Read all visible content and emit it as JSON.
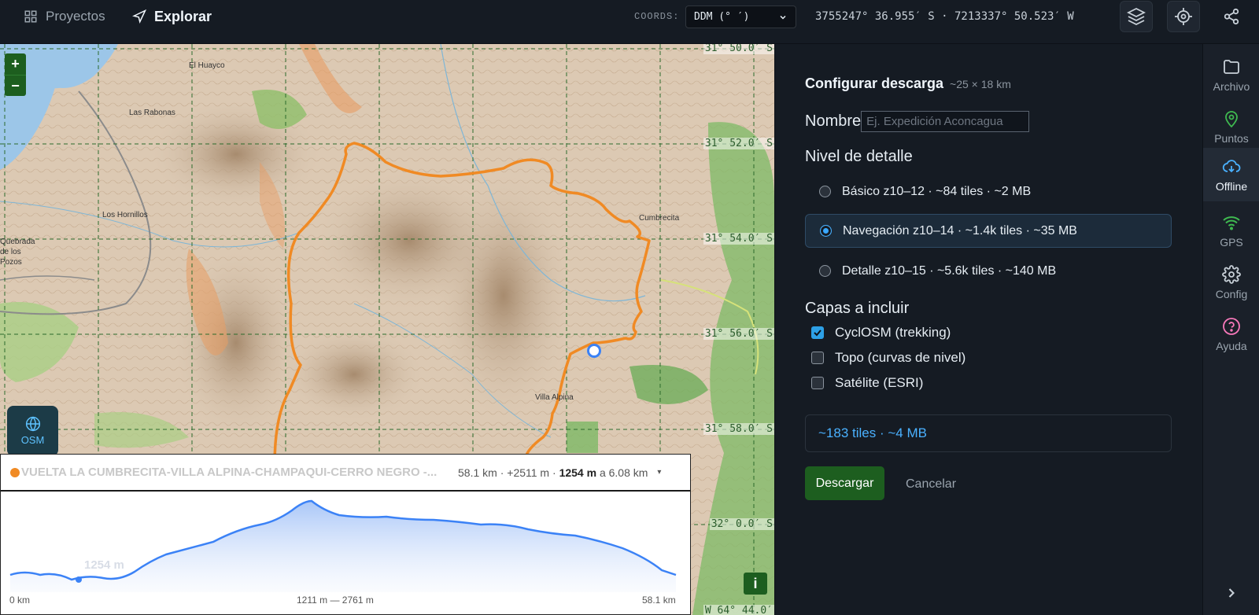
{
  "topbar": {
    "tabs": [
      {
        "label": "Proyectos",
        "icon": "grid-icon"
      },
      {
        "label": "Explorar",
        "icon": "navigation-arrow-icon"
      }
    ],
    "coords_label": "COORDS:",
    "coords_format": "DDM (° ′)",
    "coords_readout": "3755247° 36.955′ S · 7213337° 50.523′ W"
  },
  "map": {
    "lat_labels": [
      "31° 50.0′ S",
      "31° 52.0′ S",
      "31° 54.0′ S",
      "31° 56.0′ S",
      "31° 58.0′ S",
      "32° 0.0′ S",
      "W 64° 44.0′"
    ],
    "places": [
      "El Huayco",
      "Las Rabonas",
      "Los Hornillos",
      "Quebrada de los Pozos",
      "Cumbrecita",
      "Villa Alpina"
    ],
    "basemap_button": "OSM",
    "zoom_in": "+",
    "zoom_out": "−",
    "info_button": "i"
  },
  "elevation": {
    "route_name": "VUELTA LA CUMBRECITA-VILLA ALPINA-CHAMPAQUI-CERRO NEGRO -...",
    "distance": "58.1 km",
    "gain": "+2511 m",
    "cursor_elevation": "1254 m",
    "cursor_at": "a 6.08 km",
    "caret": "▾",
    "axis_start": "0 km",
    "axis_range": "1211 m — 2761 m",
    "axis_end": "58.1 km",
    "cursor_label": "1254 m"
  },
  "panel": {
    "title": "Configurar descarga",
    "subtitle": "~25 × 18 km",
    "name_label": "Nombre",
    "name_placeholder": "Ej. Expedición Aconcagua",
    "detail_heading": "Nivel de detalle",
    "detail_options": [
      {
        "label": "Básico z10–12 · ~84 tiles · ~2 MB",
        "selected": false
      },
      {
        "label": "Navegación z10–14 · ~1.4k tiles · ~35 MB",
        "selected": true
      },
      {
        "label": "Detalle z10–15 · ~5.6k tiles · ~140 MB",
        "selected": false
      }
    ],
    "layers_heading": "Capas a incluir",
    "layers": [
      {
        "label": "CyclOSM (trekking)",
        "checked": true
      },
      {
        "label": "Topo (curvas de nivel)",
        "checked": false
      },
      {
        "label": "Satélite (ESRI)",
        "checked": false
      }
    ],
    "summary": "~183 tiles · ~4 MB",
    "download_label": "Descargar",
    "cancel_label": "Cancelar"
  },
  "rail": {
    "items": [
      {
        "label": "Archivo",
        "icon": "folder-icon"
      },
      {
        "label": "Puntos",
        "icon": "map-pin-icon"
      },
      {
        "label": "Offline",
        "icon": "cloud-download-icon",
        "active": true
      },
      {
        "label": "GPS",
        "icon": "wifi-signal-icon"
      },
      {
        "label": "Config",
        "icon": "gear-icon"
      },
      {
        "label": "Ayuda",
        "icon": "help-circle-icon"
      }
    ]
  },
  "colors": {
    "accent_green": "#1d5e1f",
    "accent_blue": "#4ab1ff",
    "route_orange": "#f08a24",
    "elevation_line": "#3b82f6"
  }
}
